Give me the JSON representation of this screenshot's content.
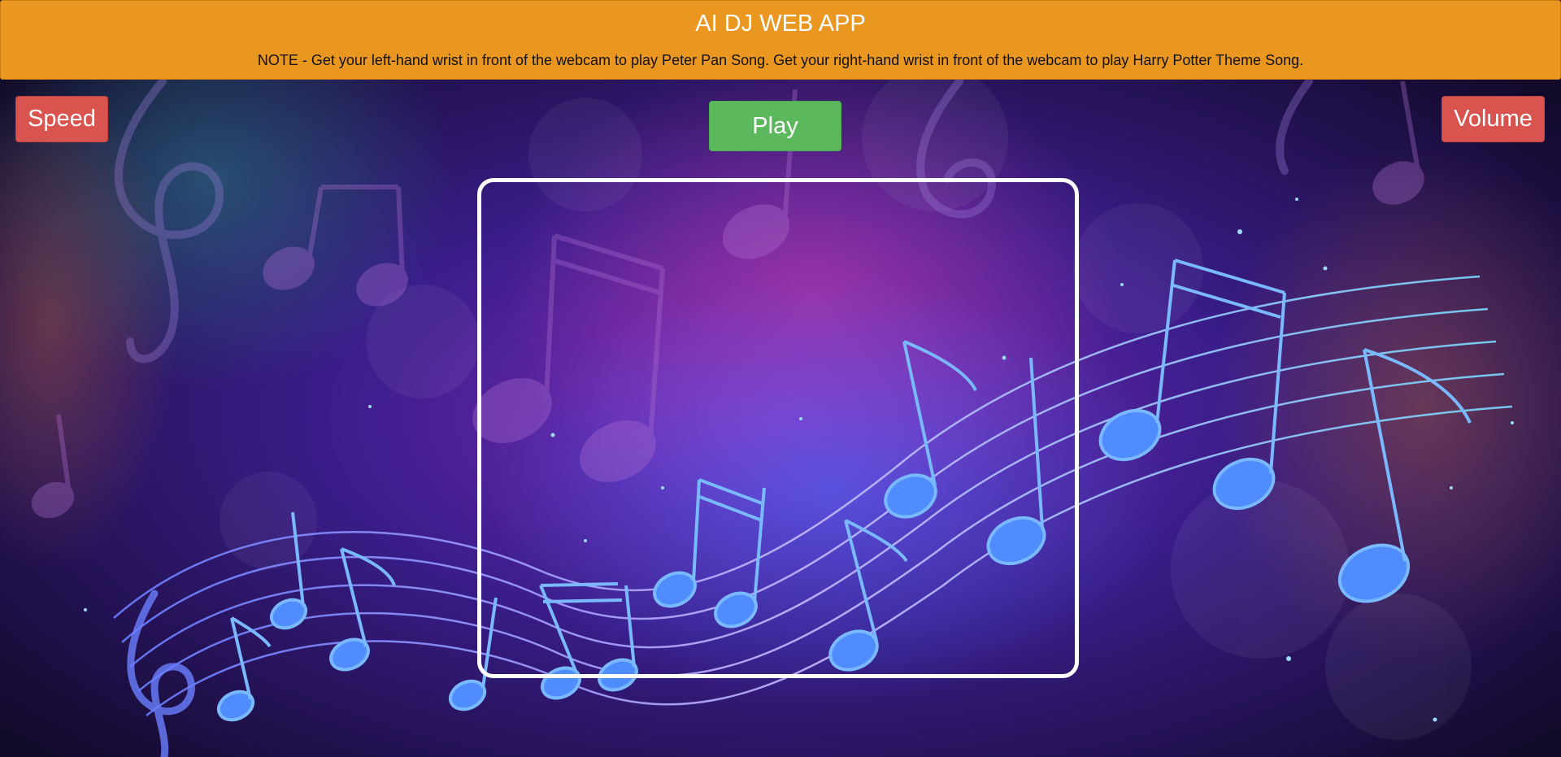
{
  "header": {
    "title": "AI DJ WEB APP",
    "note": "NOTE - Get your left-hand wrist in front of the webcam to play Peter Pan Song. Get your right-hand wrist in front of the webcam to play Harry Potter Theme Song."
  },
  "controls": {
    "speed_label": "Speed",
    "play_label": "Play",
    "volume_label": "Volume"
  },
  "webcam": {
    "state": "empty"
  },
  "background": {
    "theme": "music-notes-icon",
    "colors": {
      "deep": "#1a0f3a",
      "purple": "#7a2bb8",
      "magenta": "#c03aa0",
      "blue": "#3a5cf0",
      "cyan": "#6fd6ff",
      "teal": "#2a6a7a"
    }
  },
  "colors": {
    "header_bg": "#ea9721",
    "speed_button": "#d9534f",
    "volume_button": "#d9534f",
    "play_button": "#5cb85c",
    "frame_border": "#ffffff"
  }
}
